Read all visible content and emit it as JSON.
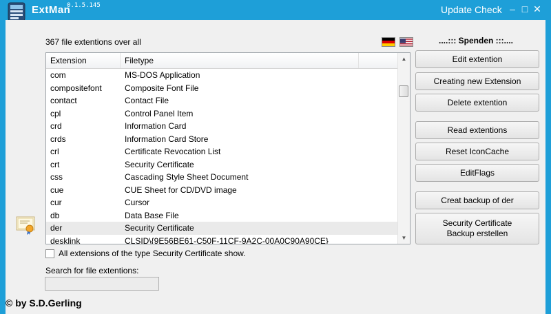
{
  "app": {
    "title": "ExtMan",
    "version": "0.1.5.145",
    "update_check": "Update Check",
    "minimize": "–",
    "maximize": "□",
    "close": "✕"
  },
  "header": {
    "file_count": "367 file extentions over all",
    "donate": "....::: Spenden :::...."
  },
  "list": {
    "columns": [
      "Extension",
      "Filetype"
    ],
    "rows": [
      {
        "ext": "com",
        "type": "MS-DOS Application"
      },
      {
        "ext": "compositefont",
        "type": "Composite Font File"
      },
      {
        "ext": "contact",
        "type": "Contact File"
      },
      {
        "ext": "cpl",
        "type": "Control Panel Item"
      },
      {
        "ext": "crd",
        "type": "Information Card"
      },
      {
        "ext": "crds",
        "type": "Information Card Store"
      },
      {
        "ext": "crl",
        "type": "Certificate Revocation List"
      },
      {
        "ext": "crt",
        "type": "Security Certificate"
      },
      {
        "ext": "css",
        "type": "Cascading Style Sheet Document"
      },
      {
        "ext": "cue",
        "type": "CUE Sheet for CD/DVD image"
      },
      {
        "ext": "cur",
        "type": "Cursor"
      },
      {
        "ext": "db",
        "type": "Data Base File"
      },
      {
        "ext": "der",
        "type": "Security Certificate",
        "selected": true
      },
      {
        "ext": "desklink",
        "type": "CLSID\\{9E56BE61-C50F-11CF-9A2C-00A0C90A90CE}"
      }
    ]
  },
  "buttons": {
    "edit": "Edit extention",
    "create": "Creating new Extension",
    "delete": "Delete extention",
    "read": "Read extentions",
    "reset_icon_cache": "Reset IconCache",
    "edit_flags": "EditFlags",
    "backup": "Creat backup of der",
    "cert_backup_line1": "Security Certificate",
    "cert_backup_line2": "Backup erstellen"
  },
  "filter": {
    "checkbox_label": "All extensions of the type Security Certificate show.",
    "search_label": "Search for file extentions:",
    "search_value": ""
  },
  "footer": {
    "copyright": "© by S.D.Gerling"
  },
  "colors": {
    "window_frame": "#1e9fd8",
    "client_bg": "#f0f0f0",
    "selected_row": "#eaeaea"
  },
  "icons": [
    "app-icon",
    "germany-flag-icon",
    "usa-flag-icon",
    "certificate-icon",
    "scroll-up-icon",
    "scroll-down-icon"
  ]
}
